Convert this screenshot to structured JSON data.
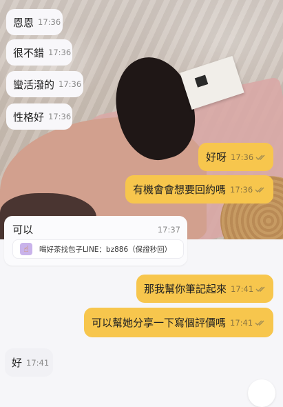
{
  "messages_top_incoming": [
    {
      "text": "恩恩",
      "time": "17:36"
    },
    {
      "text": "很不錯",
      "time": "17:36"
    },
    {
      "text": "蠻活潑的",
      "time": "17:36"
    },
    {
      "text": "性格好",
      "time": "17:36"
    }
  ],
  "messages_outgoing_1": [
    {
      "text": "好呀",
      "time": "17:36"
    },
    {
      "text": "有機會會想要回約嗎",
      "time": "17:36"
    }
  ],
  "card": {
    "text": "可以",
    "time": "17:37",
    "promo_icon": "pointing-hand-icon",
    "promo_text": "喝好茶找包子LINE：bz886（保證秒回）"
  },
  "messages_outgoing_2": [
    {
      "text": "那我幫你筆記起來",
      "time": "17:41"
    },
    {
      "text": "可以幫她分享一下寫個評價嗎",
      "time": "17:41"
    }
  ],
  "messages_bottom_incoming": [
    {
      "text": "好",
      "time": "17:41"
    }
  ],
  "colors": {
    "incoming_bubble": "#f8f7fa",
    "outgoing_bubble": "#f7c64d",
    "read_tick": "#9e8a52",
    "chat_background": "#f6f6f9"
  }
}
